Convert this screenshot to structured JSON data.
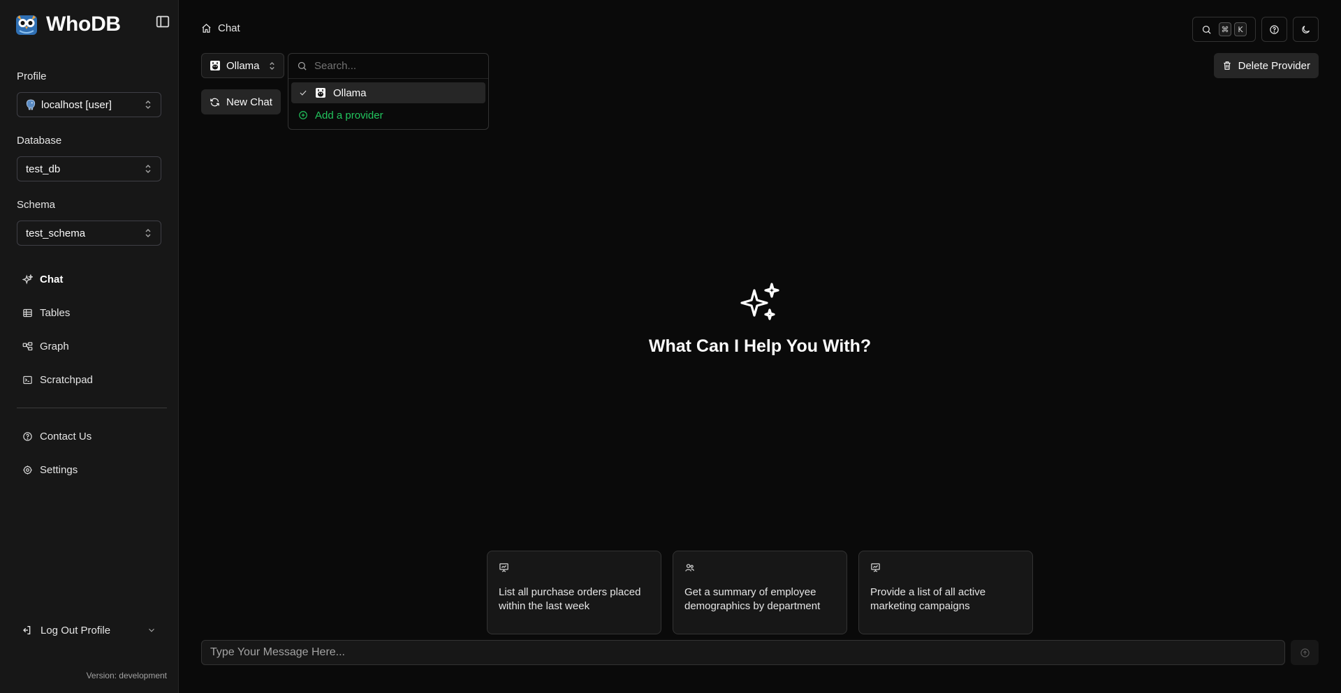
{
  "brand": {
    "name": "WhoDB",
    "logo_icon": "owl-logo-icon"
  },
  "sidebar": {
    "profile": {
      "label": "Profile",
      "value": "localhost [user]",
      "icon": "postgres-elephant-icon"
    },
    "database": {
      "label": "Database",
      "value": "test_db"
    },
    "schema": {
      "label": "Schema",
      "value": "test_schema"
    },
    "nav": [
      {
        "label": "Chat",
        "icon": "sparkles-icon",
        "active": true
      },
      {
        "label": "Tables",
        "icon": "table-icon"
      },
      {
        "label": "Graph",
        "icon": "graph-icon"
      },
      {
        "label": "Scratchpad",
        "icon": "terminal-icon"
      }
    ],
    "secondary_nav": [
      {
        "label": "Contact Us",
        "icon": "help-circle-icon"
      },
      {
        "label": "Settings",
        "icon": "settings-icon"
      }
    ],
    "logout_label": "Log Out Profile",
    "version": "Version: development"
  },
  "header": {
    "breadcrumb": "Chat",
    "kbd_modifier": "⌘",
    "kbd_key": "K"
  },
  "chat": {
    "provider_value": "Ollama",
    "new_chat_label": "New Chat",
    "delete_provider_label": "Delete Provider",
    "dropdown": {
      "search_placeholder": "Search...",
      "options": [
        {
          "label": "Ollama",
          "selected": true
        }
      ],
      "add_label": "Add a provider"
    },
    "empty_title": "What Can I Help You With?",
    "suggestions": [
      {
        "text": "List all purchase orders placed within the last week",
        "icon": "chart-presentation-icon"
      },
      {
        "text": "Get a summary of employee demographics by department",
        "icon": "users-icon"
      },
      {
        "text": "Provide a list of all active marketing campaigns",
        "icon": "chart-presentation-icon"
      }
    ],
    "message_placeholder": "Type Your Message Here..."
  },
  "colors": {
    "accent_green": "#22c55e",
    "background": "#0a0a0a",
    "sidebar": "#171717"
  }
}
